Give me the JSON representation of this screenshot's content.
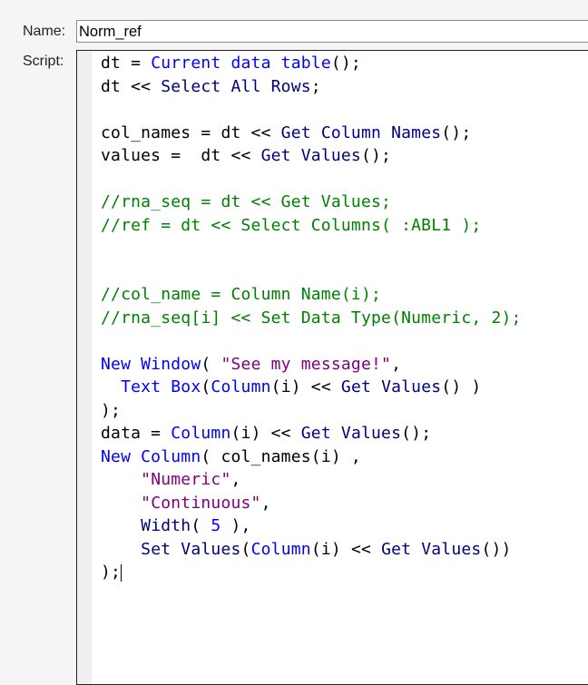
{
  "name_label": "Name:",
  "script_label": "Script:",
  "name_value": "Norm_ref",
  "colors": {
    "function": "#0000ff",
    "message": "#000080",
    "string": "#800080",
    "comment": "#008000"
  },
  "script_lines": [
    [
      [
        "id",
        "dt = "
      ],
      [
        "fn",
        "Current data table"
      ],
      [
        "id",
        "();"
      ]
    ],
    [
      [
        "id",
        "dt << "
      ],
      [
        "msg",
        "Select All Rows"
      ],
      [
        "id",
        ";"
      ]
    ],
    [],
    [
      [
        "id",
        "col_names = dt << "
      ],
      [
        "msg",
        "Get Column Names"
      ],
      [
        "id",
        "();"
      ]
    ],
    [
      [
        "id",
        "values =  dt << "
      ],
      [
        "msg",
        "Get Values"
      ],
      [
        "id",
        "();"
      ]
    ],
    [],
    [
      [
        "com",
        "//rna_seq = dt << Get Values;"
      ]
    ],
    [
      [
        "com",
        "//ref = dt << Select Columns( :ABL1 );"
      ]
    ],
    [],
    [],
    [
      [
        "com",
        "//col_name = Column Name(i);"
      ]
    ],
    [
      [
        "com",
        "//rna_seq[i] << Set Data Type(Numeric, 2);"
      ]
    ],
    [],
    [
      [
        "fn",
        "New Window"
      ],
      [
        "id",
        "( "
      ],
      [
        "str",
        "\"See my message!\""
      ],
      [
        "id",
        ","
      ]
    ],
    [
      [
        "id",
        "  "
      ],
      [
        "fn",
        "Text Box"
      ],
      [
        "id",
        "("
      ],
      [
        "fn",
        "Column"
      ],
      [
        "id",
        "(i) << "
      ],
      [
        "msg",
        "Get Values"
      ],
      [
        "id",
        "() )"
      ]
    ],
    [
      [
        "id",
        ");"
      ]
    ],
    [
      [
        "id",
        "data = "
      ],
      [
        "fn",
        "Column"
      ],
      [
        "id",
        "(i) << "
      ],
      [
        "msg",
        "Get Values"
      ],
      [
        "id",
        "();"
      ]
    ],
    [
      [
        "fn",
        "New Column"
      ],
      [
        "id",
        "( col_names(i) ,"
      ]
    ],
    [
      [
        "id",
        "    "
      ],
      [
        "str",
        "\"Numeric\""
      ],
      [
        "id",
        ","
      ]
    ],
    [
      [
        "id",
        "    "
      ],
      [
        "str",
        "\"Continuous\""
      ],
      [
        "id",
        ","
      ]
    ],
    [
      [
        "id",
        "    "
      ],
      [
        "msg",
        "Width"
      ],
      [
        "id",
        "( "
      ],
      [
        "num",
        "5"
      ],
      [
        "id",
        " ),"
      ]
    ],
    [
      [
        "id",
        "    "
      ],
      [
        "msg",
        "Set Values"
      ],
      [
        "id",
        "("
      ],
      [
        "fn",
        "Column"
      ],
      [
        "id",
        "(i) << "
      ],
      [
        "msg",
        "Get Values"
      ],
      [
        "id",
        "())"
      ]
    ],
    [
      [
        "id",
        ");"
      ]
    ]
  ]
}
